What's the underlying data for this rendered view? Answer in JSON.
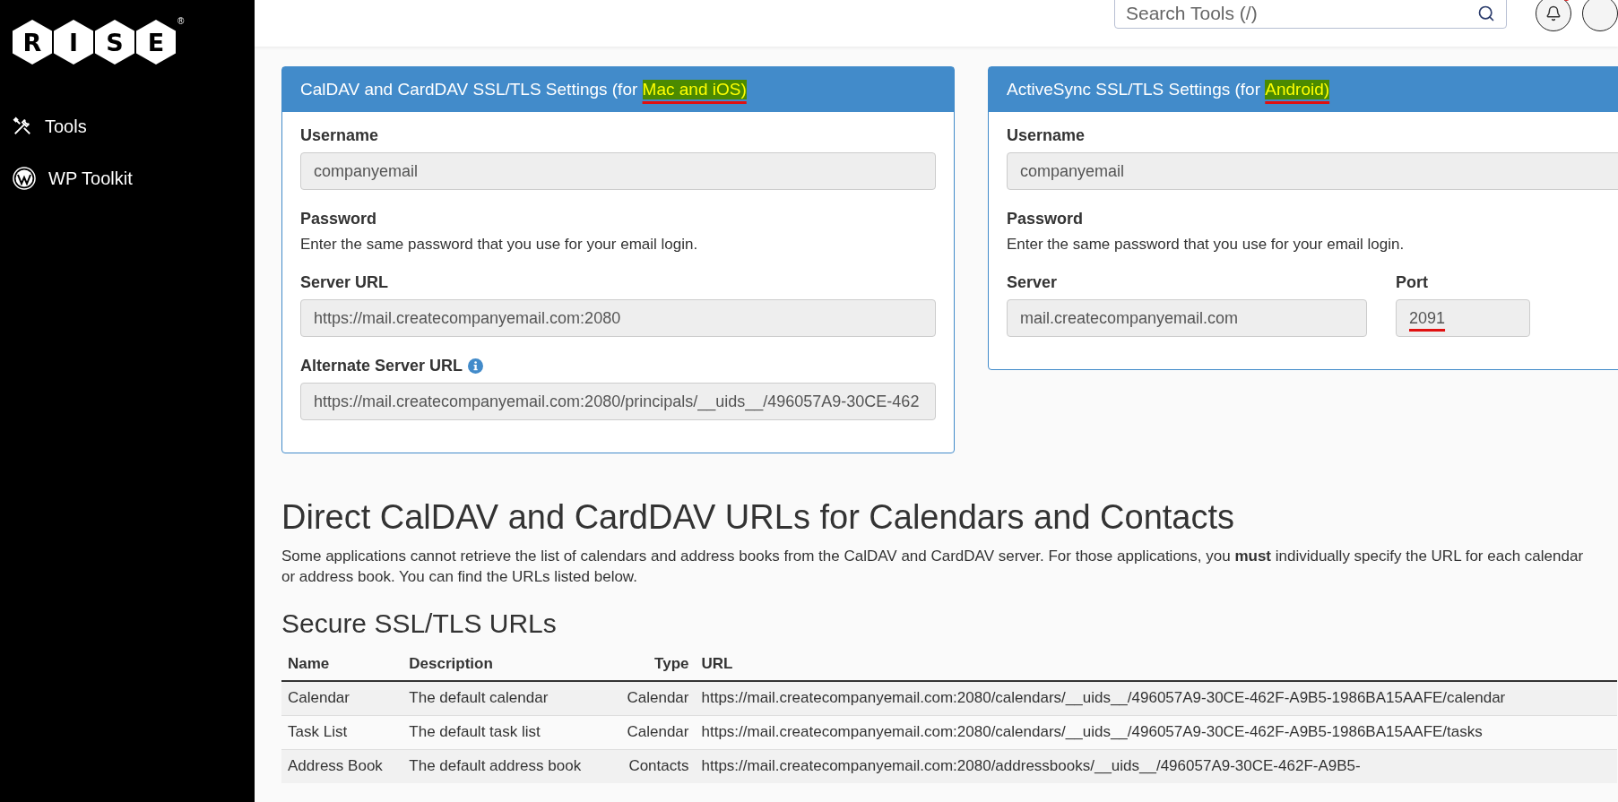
{
  "sidebar": {
    "logo": {
      "letters": [
        "R",
        "I",
        "S",
        "E"
      ],
      "mark": "®"
    },
    "items": [
      {
        "kind": "tools",
        "label": "Tools"
      },
      {
        "kind": "wordpress",
        "label": "WP Toolkit"
      }
    ]
  },
  "header": {
    "search": {
      "placeholder": "Search Tools (/)"
    },
    "notifications": {
      "unread": true
    }
  },
  "cards": [
    {
      "title": "CalDAV and CardDAV SSL/TLS Settings (for ",
      "highlight": "Mac and iOS)",
      "rows": [
        {
          "fields": [
            {
              "label": "Username",
              "value": "companyemail"
            }
          ]
        },
        {
          "fields": [
            {
              "label": "Password",
              "hint": "Enter the same password that you use for your email login."
            }
          ]
        },
        {
          "fields": [
            {
              "label": "Server URL",
              "value": "https://mail.createcompanyemail.com:2080"
            }
          ]
        },
        {
          "fields": [
            {
              "label": "Alternate Server URL",
              "info": true,
              "value": "https://mail.createcompanyemail.com:2080/principals/__uids__/496057A9-30CE-462"
            }
          ]
        }
      ]
    },
    {
      "title": "ActiveSync SSL/TLS Settings (for ",
      "highlight": "Android)",
      "rows": [
        {
          "fields": [
            {
              "label": "Username",
              "value": "companyemail"
            }
          ]
        },
        {
          "fields": [
            {
              "label": "Password",
              "hint": "Enter the same password that you use for your email login."
            }
          ]
        },
        {
          "fields": [
            {
              "label": "Server",
              "value": "mail.createcompanyemail.com"
            },
            {
              "label": "Port",
              "value": "2091",
              "underlined": true
            }
          ]
        }
      ]
    }
  ],
  "section": {
    "heading": "Direct CalDAV and CardDAV URLs for Calendars and Contacts",
    "intro": "Some applications cannot retrieve the list of calendars and address books from the CalDAV and CardDAV server. For those applications, you **must** individually specify the URL for each calendar or address book. You can find the URLs listed below.",
    "subheading": "Secure SSL/TLS URLs",
    "table": {
      "columns": [
        "Name",
        "Description",
        "Type",
        "URL"
      ],
      "rows": [
        [
          "Calendar",
          "The default calendar",
          "Calendar",
          "https://mail.createcompanyemail.com:2080/calendars/__uids__/496057A9-30CE-462F-A9B5-1986BA15AAFE/calendar"
        ],
        [
          "Task List",
          "The default task list",
          "Calendar",
          "https://mail.createcompanyemail.com:2080/calendars/__uids__/496057A9-30CE-462F-A9B5-1986BA15AAFE/tasks"
        ],
        [
          "Address Book",
          "The default address book",
          "Contacts",
          "https://mail.createcompanyemail.com:2080/addressbooks/__uids__/496057A9-30CE-462F-A9B5-"
        ]
      ]
    }
  }
}
